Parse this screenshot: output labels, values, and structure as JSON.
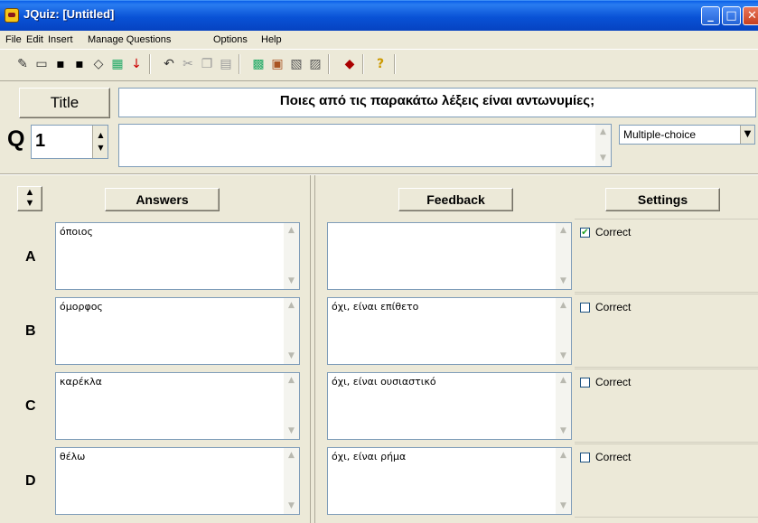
{
  "window": {
    "title": "JQuiz: [Untitled]"
  },
  "menu": [
    "File",
    "Edit",
    "Insert",
    "Manage Questions",
    "Options",
    "Help"
  ],
  "toolbar_icons": [
    "new-icon",
    "open-icon",
    "save-icon",
    "save-as-icon",
    "export-icon",
    "grid-icon",
    "arrow-down-icon",
    "undo-icon",
    "cut-icon",
    "copy-icon",
    "paste-icon",
    "web-page-icon",
    "upload-icon",
    "hot-potatoes-icon",
    "masher-icon",
    "config-icon",
    "help-icon"
  ],
  "title_section": {
    "label": "Title",
    "value": "Ποιες από τις παρακάτω λέξεις είναι αντωνυμίες;"
  },
  "question": {
    "label": "Q",
    "number": "1",
    "text": "",
    "type": "Multiple-choice"
  },
  "headers": {
    "answers": "Answers",
    "feedback": "Feedback",
    "settings": "Settings"
  },
  "answers": [
    {
      "letter": "A",
      "answer": "όποιος",
      "feedback": "",
      "correct_label": "Correct",
      "correct": true
    },
    {
      "letter": "B",
      "answer": "όμορφος",
      "feedback": "όχι, είναι επίθετο",
      "correct_label": "Correct",
      "correct": false
    },
    {
      "letter": "C",
      "answer": "καρέκλα",
      "feedback": "όχι, είναι ουσιαστικό",
      "correct_label": "Correct",
      "correct": false
    },
    {
      "letter": "D",
      "answer": "θέλω",
      "feedback": "όχι, είναι ρήμα",
      "correct_label": "Correct",
      "correct": false
    }
  ]
}
